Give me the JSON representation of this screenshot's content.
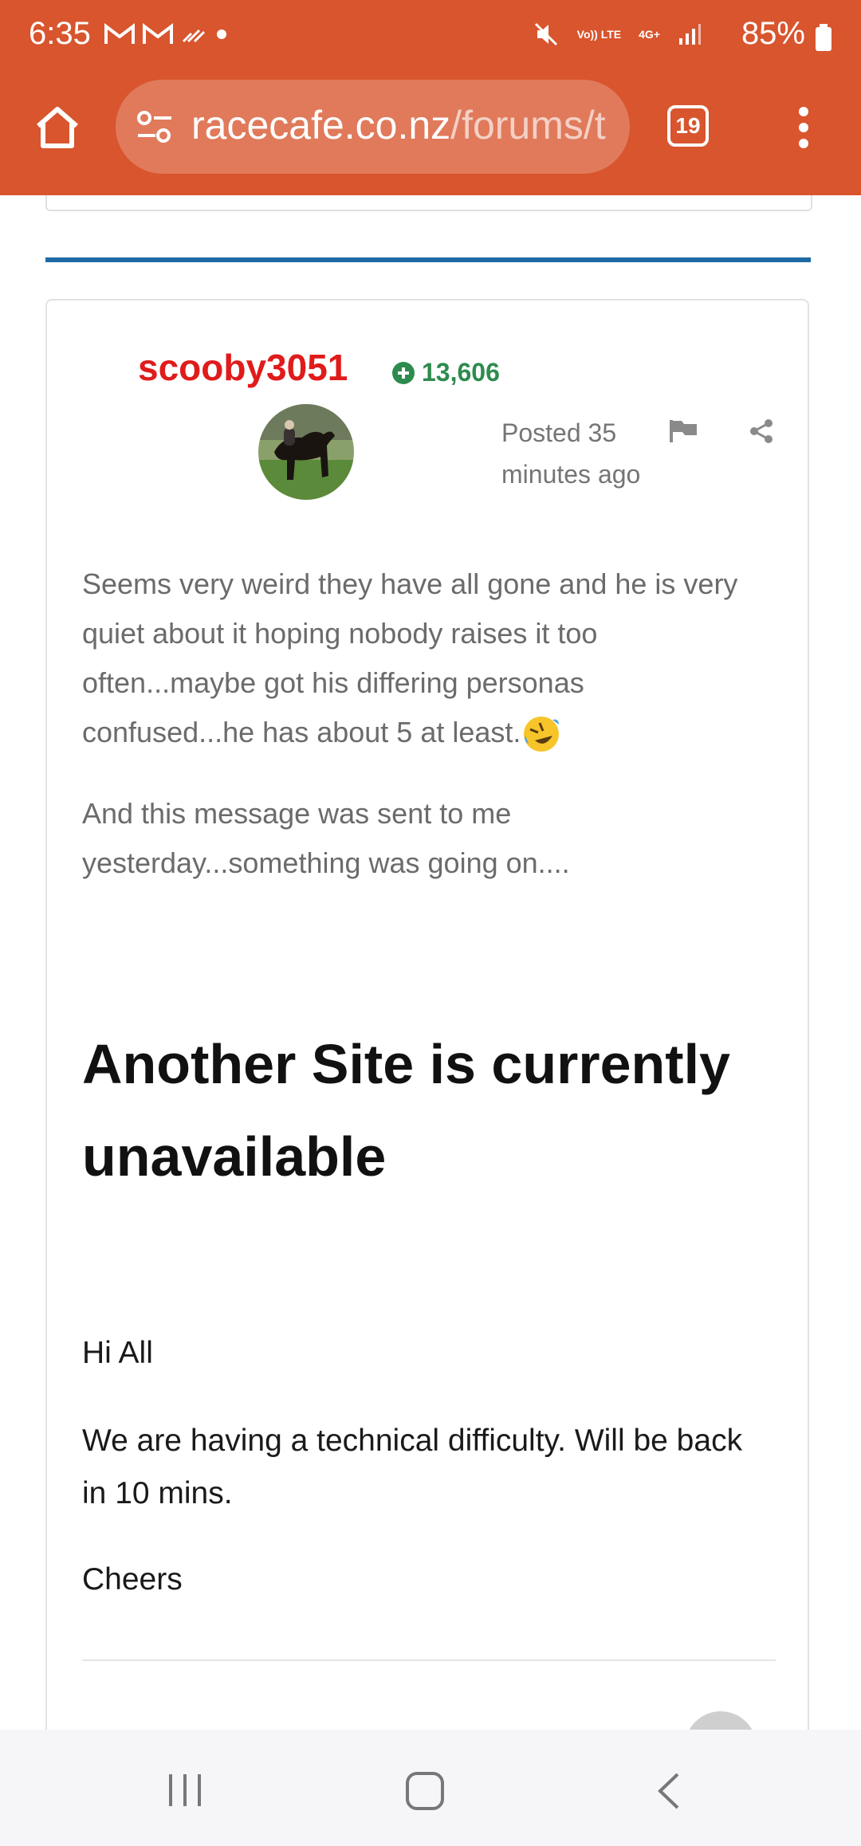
{
  "status_bar": {
    "time": "6:35",
    "battery": "85%",
    "network": "4G+",
    "volte": "Vo)) LTE"
  },
  "browser": {
    "url_domain": "racecafe.co.nz",
    "url_path": "/forums/t",
    "tab_count": "19"
  },
  "post": {
    "author": "scooby3051",
    "reputation": "13,606",
    "posted_time": "Posted 35 minutes ago",
    "body_paragraphs": [
      "Seems very weird they have all gone and he is very quiet about it hoping nobody raises it too often...maybe got his differing personas confused...he has about 5 at least.",
      "And this message was sent to me yesterday...something was going on...."
    ],
    "emoji": "rolling-on-floor-laughing",
    "quoted_message": {
      "headline": "Another Site is currently unavailable",
      "greeting": "Hi All",
      "message": "We are having a technical difficulty.  Will be back in 10 mins.",
      "signoff": "Cheers"
    }
  },
  "colors": {
    "chrome": "#d8552e",
    "author": "#e01b1b",
    "reputation": "#2e8b4e",
    "divider_accent": "#1f6aa5"
  }
}
